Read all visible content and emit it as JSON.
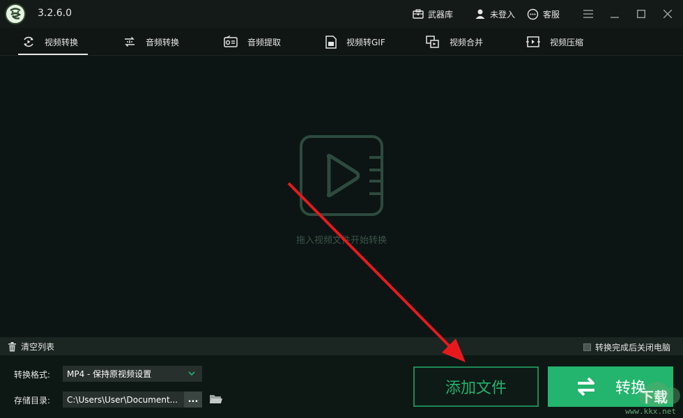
{
  "app": {
    "version": "3.2.6.0"
  },
  "titlebar": {
    "arsenal": "武器库",
    "login": "未登入",
    "service": "客服"
  },
  "tabs": [
    {
      "label": "视频转换",
      "icon": "video-convert-icon",
      "active": true
    },
    {
      "label": "音频转换",
      "icon": "audio-convert-icon",
      "active": false
    },
    {
      "label": "音频提取",
      "icon": "audio-extract-icon",
      "active": false
    },
    {
      "label": "视频转GIF",
      "icon": "gif-icon",
      "active": false
    },
    {
      "label": "视频合并",
      "icon": "merge-icon",
      "active": false
    },
    {
      "label": "视频压缩",
      "icon": "compress-icon",
      "active": false
    }
  ],
  "dropzone": {
    "hint": "拖入视频文件开始转换"
  },
  "listbar": {
    "clear": "清空列表",
    "shutdown": "转换完成后关闭电脑"
  },
  "settings": {
    "format_label": "转换格式:",
    "format_value": "MP4 - 保持原视频设置",
    "dir_label": "存储目录:",
    "dir_value": "C:\\Users\\User\\Document...",
    "browse": "..."
  },
  "actions": {
    "add": "添加文件",
    "convert": "转换"
  },
  "watermark": {
    "text": "www.kkx.net",
    "logo": "下载"
  },
  "colors": {
    "accent": "#23b46e",
    "arrow": "#e8191d",
    "background": "#0d1714"
  }
}
